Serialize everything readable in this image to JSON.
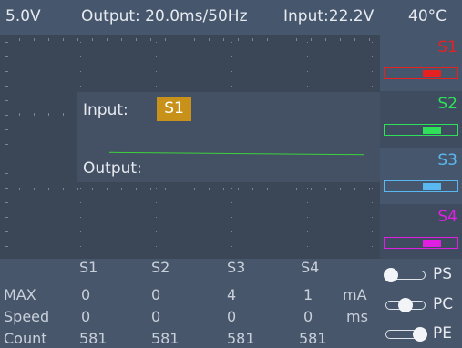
{
  "status_bar": {
    "voltage": "5.0V",
    "output": "Output: 20.0ms/50Hz",
    "input": "Input:22.2V",
    "temperature": "40°C"
  },
  "routing": {
    "input_label": "Input:",
    "input_channel": "S1",
    "output_label": "Output:"
  },
  "channels": [
    {
      "name": "S1",
      "color": "#e52222",
      "level": 0.65
    },
    {
      "name": "S2",
      "color": "#2ee05a",
      "level": 0.65
    },
    {
      "name": "S3",
      "color": "#5ab8f0",
      "level": 0.65
    },
    {
      "name": "S4",
      "color": "#e020e0",
      "level": 0.65
    }
  ],
  "readout": {
    "headers": [
      "S1",
      "S2",
      "S3",
      "S4"
    ],
    "rows": [
      {
        "label": "MAX",
        "values": [
          "0",
          "0",
          "4",
          "1"
        ],
        "unit": "mA"
      },
      {
        "label": "Speed",
        "values": [
          "0",
          "0",
          "0",
          "0"
        ],
        "unit": "ms"
      },
      {
        "label": "Count",
        "values": [
          "581",
          "581",
          "581",
          "581"
        ],
        "unit": ""
      }
    ]
  },
  "modes": [
    {
      "label": "PS",
      "position": 0
    },
    {
      "label": "PC",
      "position": 0.5
    },
    {
      "label": "PE",
      "position": 1
    }
  ],
  "colors": {
    "background": "#3f4b5e",
    "scope": "#3b4657",
    "badge": "#c8921a",
    "trace": "#3cd23c"
  }
}
